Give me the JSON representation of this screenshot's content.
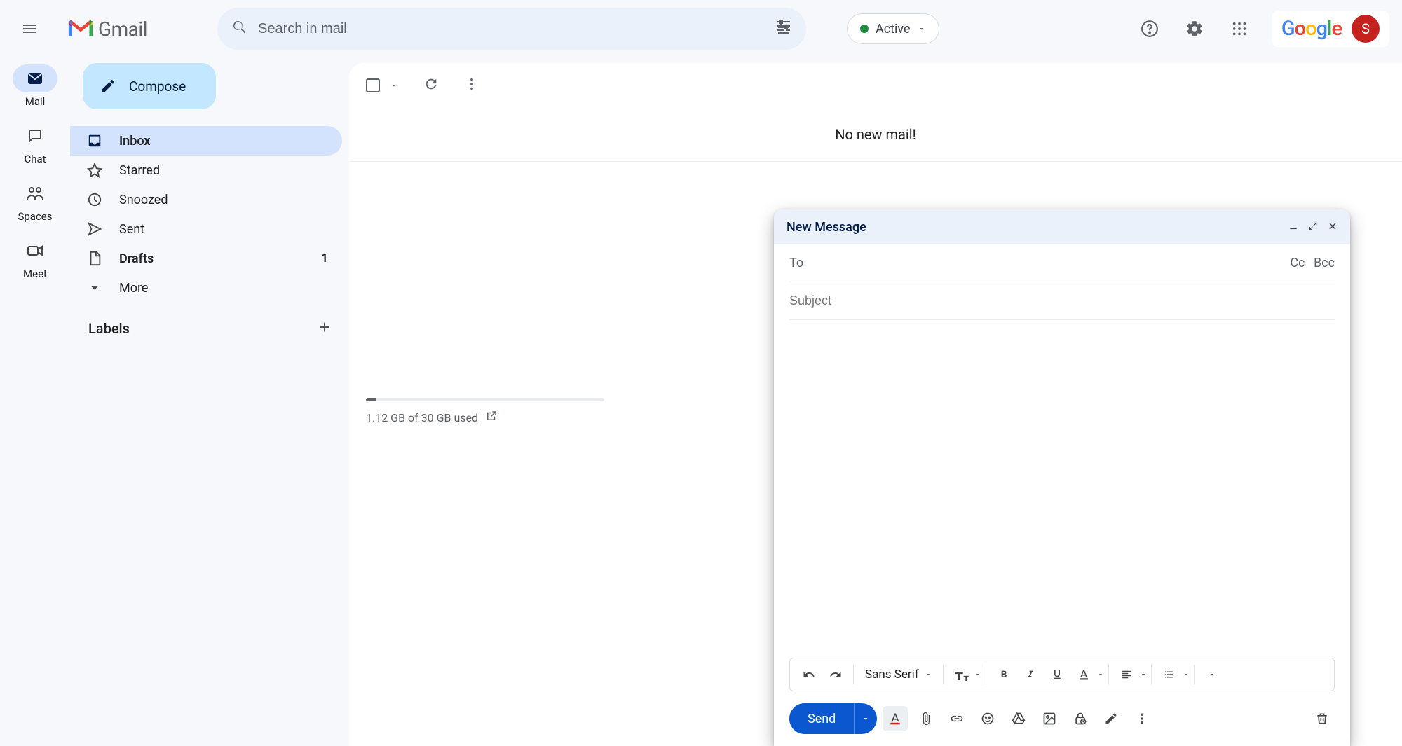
{
  "header": {
    "brand_text": "Gmail",
    "search_placeholder": "Search in mail",
    "status_label": "Active",
    "google_text": "Google",
    "avatar_initial": "S"
  },
  "rail": {
    "items": [
      {
        "label": "Mail"
      },
      {
        "label": "Chat"
      },
      {
        "label": "Spaces"
      },
      {
        "label": "Meet"
      }
    ]
  },
  "sidebar": {
    "compose_label": "Compose",
    "items": [
      {
        "label": "Inbox",
        "count": ""
      },
      {
        "label": "Starred",
        "count": ""
      },
      {
        "label": "Snoozed",
        "count": ""
      },
      {
        "label": "Sent",
        "count": ""
      },
      {
        "label": "Drafts",
        "count": "1"
      },
      {
        "label": "More",
        "count": ""
      }
    ],
    "labels_title": "Labels"
  },
  "content": {
    "empty_text": "No new mail!",
    "storage_text": "1.12 GB of 30 GB used"
  },
  "compose": {
    "title": "New Message",
    "to_label": "To",
    "cc_label": "Cc",
    "bcc_label": "Bcc",
    "subject_placeholder": "Subject",
    "font_name": "Sans Serif",
    "send_label": "Send"
  }
}
